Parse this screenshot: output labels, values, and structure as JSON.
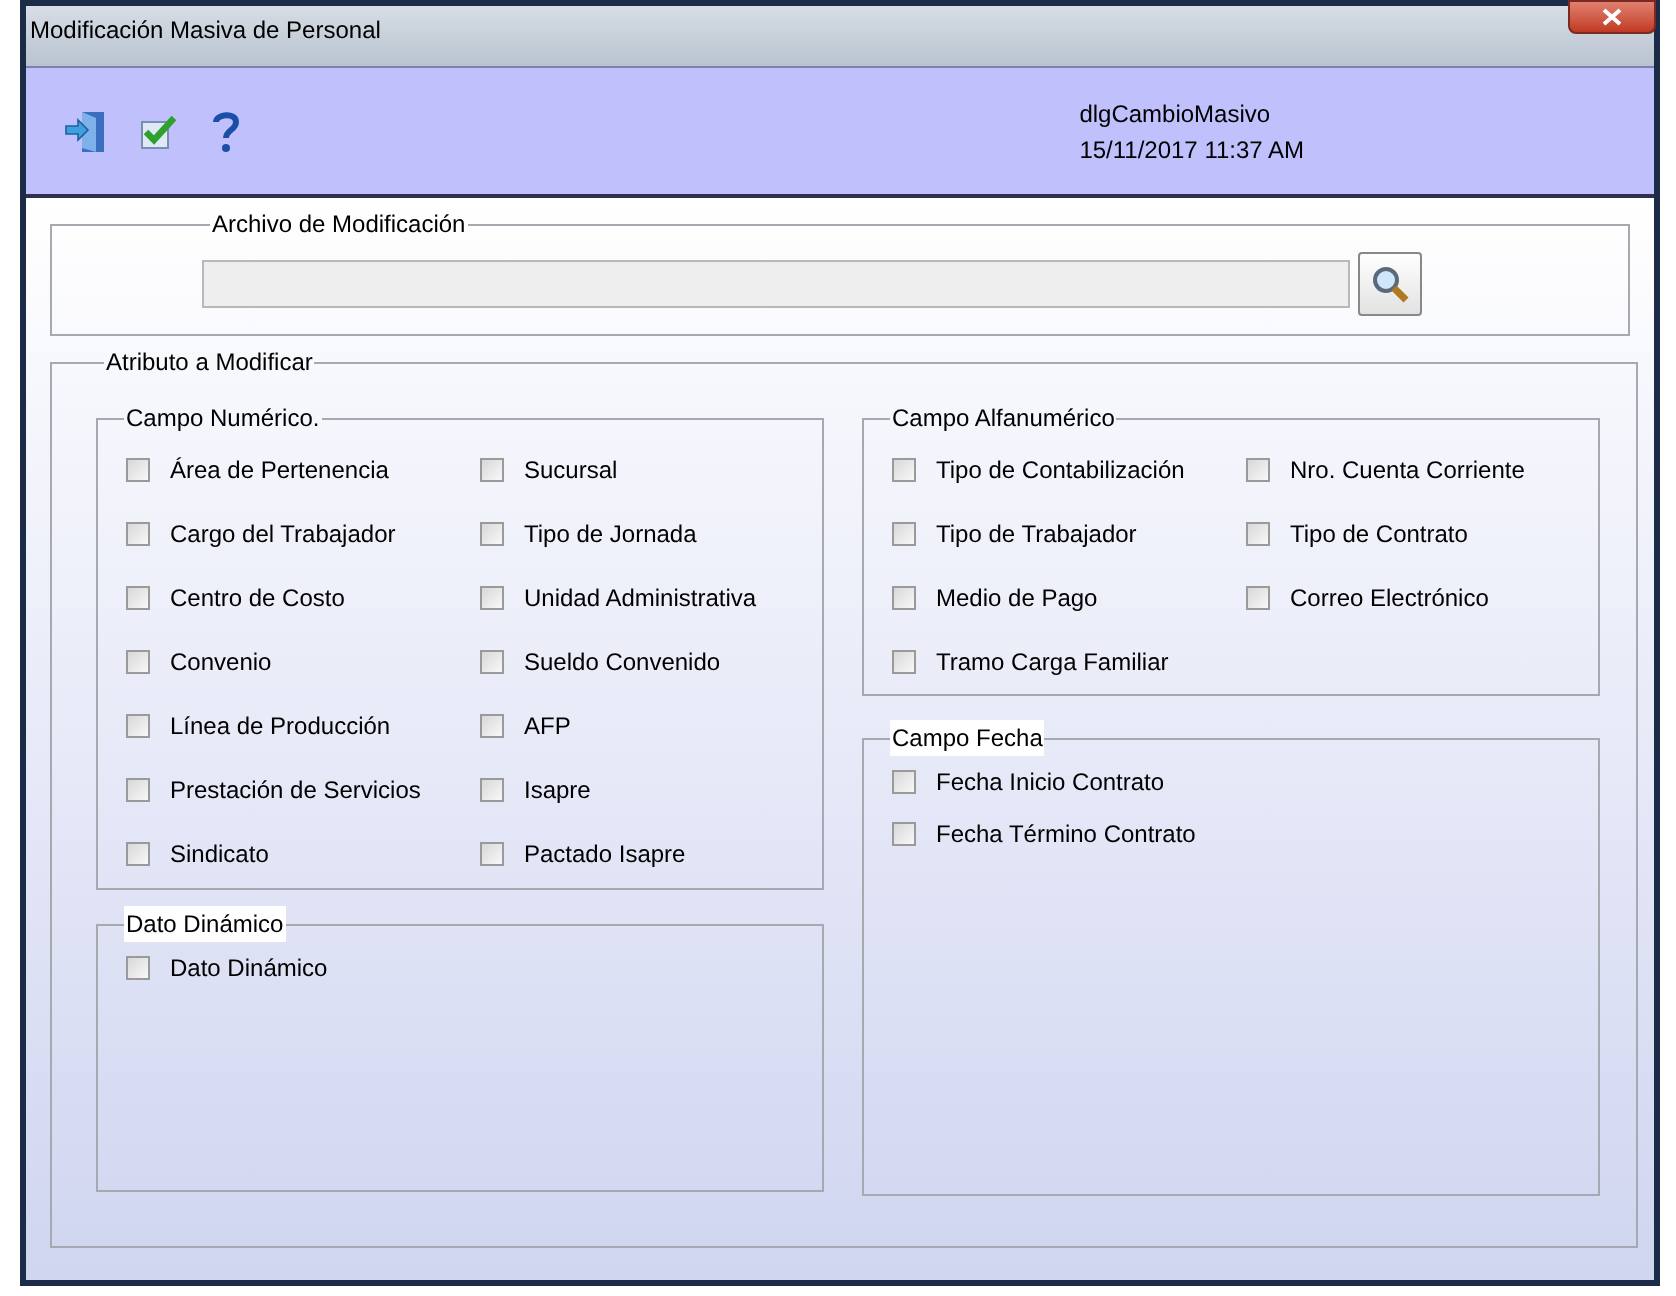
{
  "window": {
    "title": "Modificación Masiva de Personal"
  },
  "header": {
    "form_name": "dlgCambioMasivo",
    "timestamp": "15/11/2017 11:37 AM"
  },
  "file_section": {
    "title": "Archivo de Modificación"
  },
  "attribute_section": {
    "title": "Atributo a Modificar",
    "left_groups": [
      {
        "title": "Campo Numérico.",
        "items": [
          {
            "label": "Área de Pertenencia",
            "checked": false
          },
          {
            "label": "Sucursal",
            "checked": false
          },
          {
            "label": "Cargo del Trabajador",
            "checked": false
          },
          {
            "label": "Tipo de Jornada",
            "checked": false
          },
          {
            "label": "Centro de Costo",
            "checked": false
          },
          {
            "label": "Unidad Administrativa",
            "checked": false
          },
          {
            "label": "Convenio",
            "checked": false
          },
          {
            "label": "Sueldo Convenido",
            "checked": false
          },
          {
            "label": "Línea de Producción",
            "checked": false
          },
          {
            "label": "AFP",
            "checked": false
          },
          {
            "label": "Prestación de Servicios",
            "checked": false
          },
          {
            "label": "Isapre",
            "checked": false
          },
          {
            "label": "Sindicato",
            "checked": false
          },
          {
            "label": "Pactado Isapre",
            "checked": false
          }
        ]
      },
      {
        "title": "Dato Dinámico",
        "items": [
          {
            "label": "Dato Dinámico",
            "checked": false
          }
        ]
      }
    ],
    "right_groups": [
      {
        "title": "Campo Alfanumérico",
        "items": [
          {
            "label": "Tipo de Contabilización",
            "checked": false
          },
          {
            "label": "Nro. Cuenta Corriente",
            "checked": false
          },
          {
            "label": "Tipo de Trabajador",
            "checked": false
          },
          {
            "label": "Tipo de Contrato",
            "checked": false
          },
          {
            "label": "Medio de Pago",
            "checked": false
          },
          {
            "label": "Correo Electrónico",
            "checked": false
          },
          {
            "label": "Tramo Carga Familiar",
            "checked": false
          }
        ]
      },
      {
        "title": "Campo Fecha",
        "items": [
          {
            "label": "Fecha Inicio Contrato",
            "checked": false
          },
          {
            "label": "Fecha Término Contrato",
            "checked": false
          }
        ]
      }
    ]
  }
}
